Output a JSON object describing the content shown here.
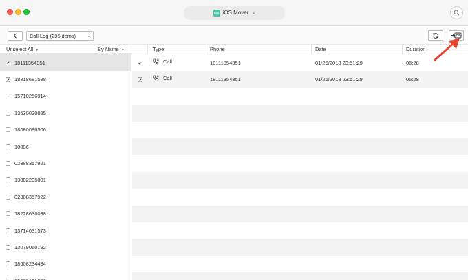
{
  "titlebar": {
    "device_badge": "iOS",
    "device_name": "iOS Mover"
  },
  "toolbar": {
    "category_select": "Call Log (295 items)"
  },
  "left_panel": {
    "unselect_all": "Unselect All",
    "sort_by": "By Name",
    "contacts": [
      {
        "number": "18111354351",
        "checked": true
      },
      {
        "number": "18818681538",
        "checked": true
      },
      {
        "number": "15710256914",
        "checked": false
      },
      {
        "number": "13530020895",
        "checked": false
      },
      {
        "number": "18080086506",
        "checked": false
      },
      {
        "number": "10086",
        "checked": false
      },
      {
        "number": "02388357921",
        "checked": false
      },
      {
        "number": "13882205001",
        "checked": false
      },
      {
        "number": "02388357922",
        "checked": false
      },
      {
        "number": "18228638098",
        "checked": false
      },
      {
        "number": "13714031573",
        "checked": false
      },
      {
        "number": "13079060192",
        "checked": false
      },
      {
        "number": "18608234434",
        "checked": false
      },
      {
        "number": "13608101001",
        "checked": false
      }
    ]
  },
  "table": {
    "headers": {
      "type": "Type",
      "phone": "Phone",
      "date": "Date",
      "duration": "Duration"
    },
    "rows": [
      {
        "type": "Call",
        "phone": "18111354351",
        "date": "01/26/2018 23:51:29",
        "duration": "06:28",
        "checked": true
      },
      {
        "type": "Call",
        "phone": "18111354351",
        "date": "01/26/2018 23:51:29",
        "duration": "06:28",
        "checked": true
      }
    ]
  },
  "colors": {
    "accent": "#4cc3a6",
    "arrow": "#e8432d"
  }
}
